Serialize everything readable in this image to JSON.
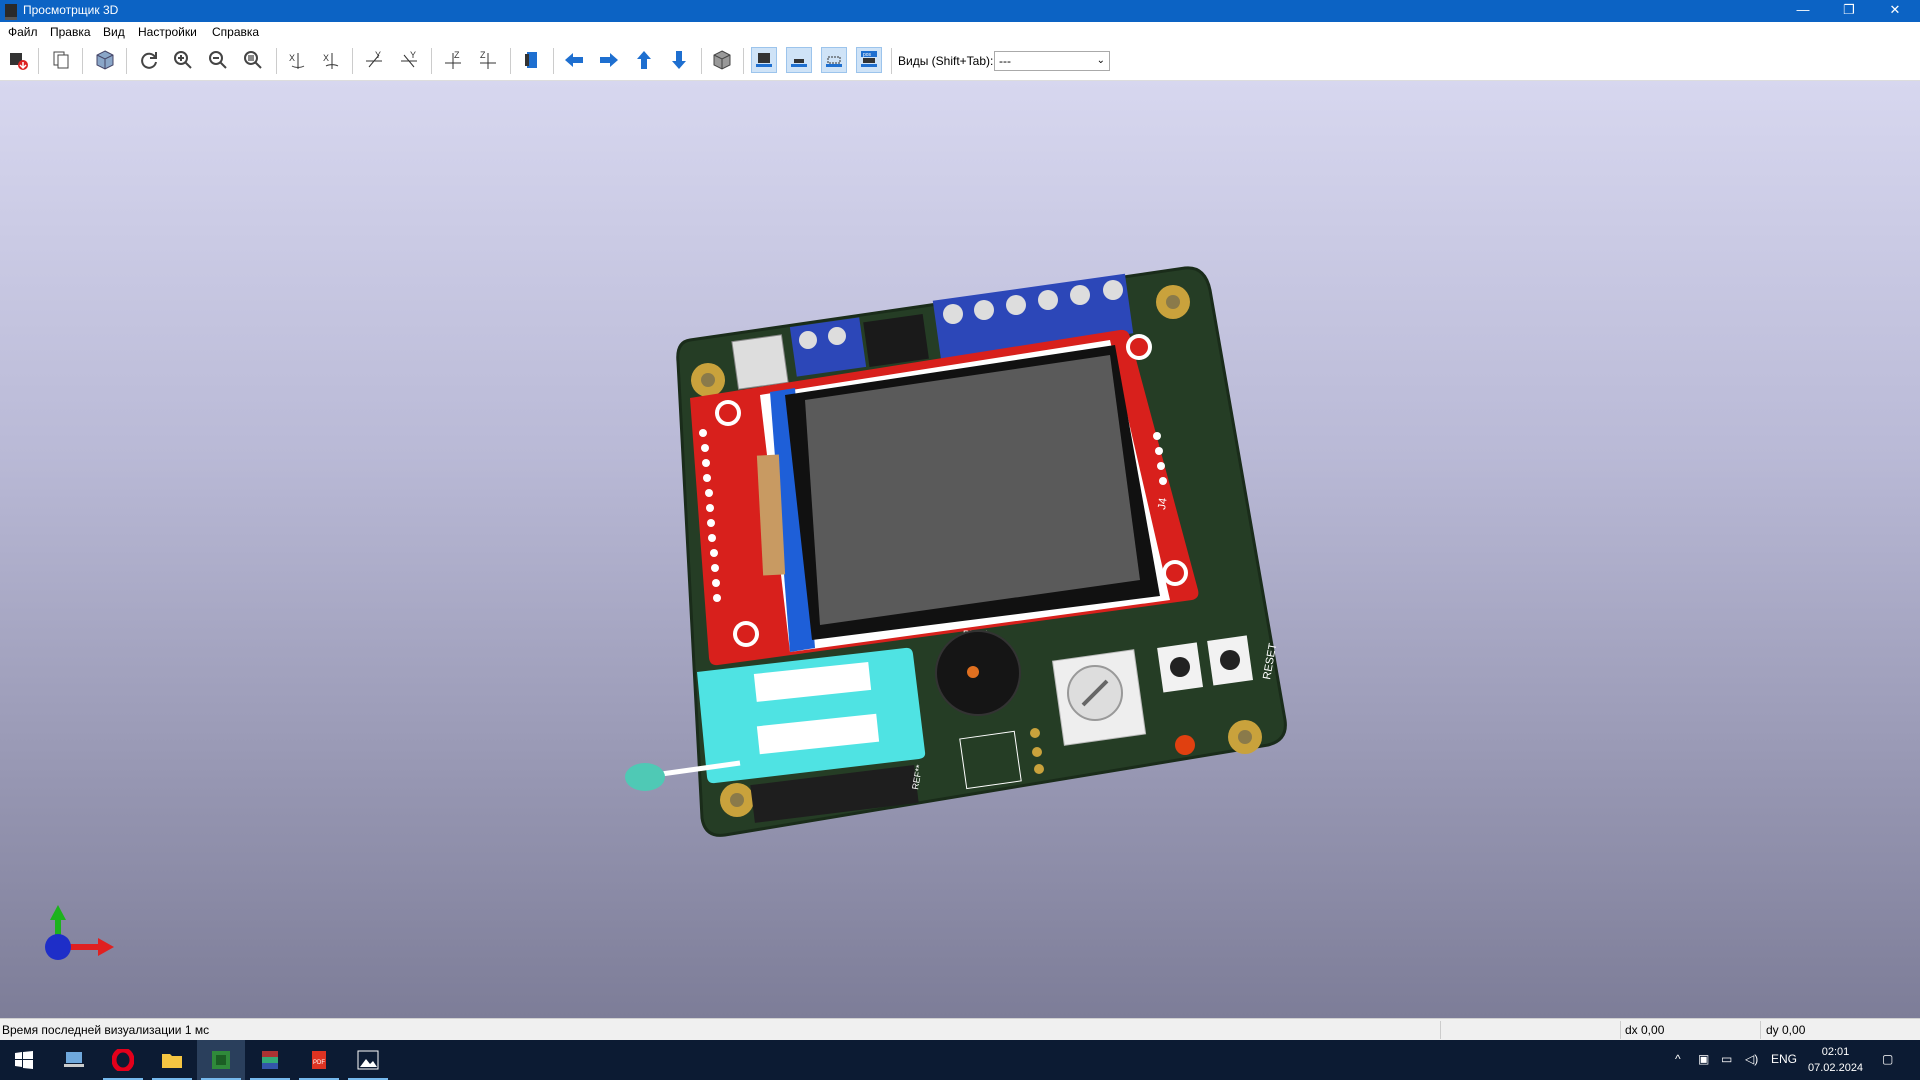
{
  "window": {
    "title": "Просмотрщик 3D"
  },
  "window_controls": {
    "minimize": "—",
    "restore": "❐",
    "close": "✕"
  },
  "menu": [
    "Файл",
    "Правка",
    "Вид",
    "Настройки",
    "Справка"
  ],
  "toolbar": {
    "views_label": "Виды (Shift+Tab):",
    "views_value": "---",
    "icons": [
      "export-icon",
      "copy-icon",
      "render-3d-icon",
      "reload-icon",
      "zoom-in-icon",
      "zoom-out-icon",
      "zoom-fit-icon",
      "rotate-x-cw-icon",
      "rotate-x-ccw-icon",
      "rotate-y-cw-icon",
      "rotate-y-ccw-icon",
      "rotate-z-cw-icon",
      "rotate-z-ccw-icon",
      "flip-board-icon",
      "pan-left-icon",
      "pan-right-icon",
      "pan-up-icon",
      "pan-down-icon",
      "perspective-icon",
      "show-tht-icon",
      "show-smd-icon",
      "show-virtual-icon",
      "show-not-in-pos-icon"
    ]
  },
  "board": {
    "silk_ref_top": "REF**",
    "silk_ref_bottom": "REF**",
    "silk_j4": "J4",
    "silk_reset": "RESET"
  },
  "colors": {
    "pcb": "#1f3a1f",
    "display_red": "#d8201c",
    "terminal_blue": "#2c47b8",
    "zif_cyan": "#4fe3e3",
    "pad_gold": "#c9a23c"
  },
  "status": {
    "message": "Время последней визуализации 1 мс",
    "dx": "dx 0,00",
    "dy": "dy 0,00"
  },
  "taskbar": {
    "apps": [
      "start-icon",
      "windows-search-icon",
      "opera-icon",
      "file-explorer-icon",
      "kicad-icon",
      "winrar-icon",
      "pdf-reader-icon",
      "photos-icon"
    ],
    "lang": "ENG",
    "time": "02:01",
    "date": "07.02.2024"
  }
}
